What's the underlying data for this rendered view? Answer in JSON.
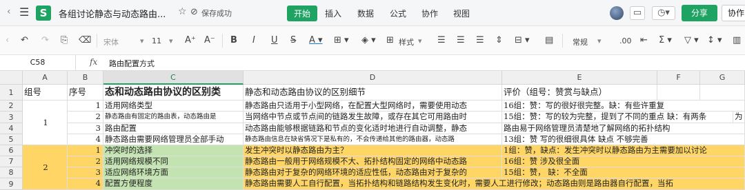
{
  "titlebar": {
    "hamburger_icon": "menu-icon",
    "logo_letter": "S",
    "doc_title": "各组讨论静态与动态路由...",
    "saved_text": "保存成功",
    "menus": [
      "开始",
      "插入",
      "数据",
      "公式",
      "协作",
      "视图"
    ],
    "share_label": "分享",
    "collab_label": "协作"
  },
  "toolbar": {
    "font_name": "宋体",
    "font_size": "11",
    "style_label": "样式",
    "number_format": "常规"
  },
  "formula_bar": {
    "cell_ref": "C58",
    "fx": "fx",
    "content": "路由配置方式"
  },
  "columns": [
    "A",
    "B",
    "C",
    "D",
    "E",
    "F",
    "G"
  ],
  "rows": [
    "1",
    "2",
    "3",
    "4",
    "5",
    "6",
    "7",
    "8",
    "9"
  ],
  "sheet": {
    "header": {
      "a": "组号",
      "b": "序号",
      "c": "态和动态路由协议的区别类",
      "d": "静态和动态路由协议的区别细节",
      "e": "评价（组号：赞赏与缺点）"
    },
    "group1": "1",
    "group2": "2",
    "r2": {
      "b": "1",
      "c": "适用网络类型",
      "d": "静态路由只适用于小型网络，在配置大型网络时，需要使用动态",
      "e": "16组：赞：写的很好很完整。缺：有些许重复"
    },
    "r3": {
      "b": "2",
      "c": "静态路由有固定的路由表，动态路由是",
      "d": "当网络中节点或节点间的链路发生故障，或存在其它可用路由时",
      "e": "15组：赞：写的较为完整，提到了不同的重点  缺：有两条",
      "e2": "为"
    },
    "r4": {
      "b": "3",
      "c": "路由配置",
      "d": "动态路由能够根据链路和节点的变化适时地进行自动调整，静态",
      "e": "路由易于网络管理员清楚地了解网络的拓扑结构"
    },
    "r5": {
      "b": "4",
      "c": "静态路由需要网络管理员全部手动",
      "d": "静态路由信息在缺省情况下是私有的，不会传递给其他的路由器，动态路",
      "e": "13组：赞 写的很细很具体  缺点  不够完善"
    },
    "r6": {
      "b": "1",
      "c": "冲突时的选择",
      "d": "发生冲突时以静态路由为主？",
      "e": "1组：赞，缺点：发生冲突时以静态路由为主需要加以讨论"
    },
    "r7": {
      "b": "2",
      "c": "适用网络规模不同",
      "d": "静态路由一般用于网络规模不大、拓扑结构固定的网络中动态路",
      "e": "16组：赞 涉及很全面"
    },
    "r8": {
      "b": "3",
      "c": "适应网络环境方面",
      "d": "静态路由对于复杂的网络环境的适应性低，动态路由对于复杂的",
      "e": "15组：赞，  缺：不全面"
    },
    "r9": {
      "b": "4",
      "c": "配置方便程度",
      "d": "静态路由需要人工自行配置，当拓扑结构和链路结构发生变化时，需要人工进行修改；动态路由则是路由器自行配置，当拓"
    }
  },
  "colors": {
    "brand": "#1ea362",
    "yellow": "#ffd666",
    "green": "#c3e3b1"
  }
}
